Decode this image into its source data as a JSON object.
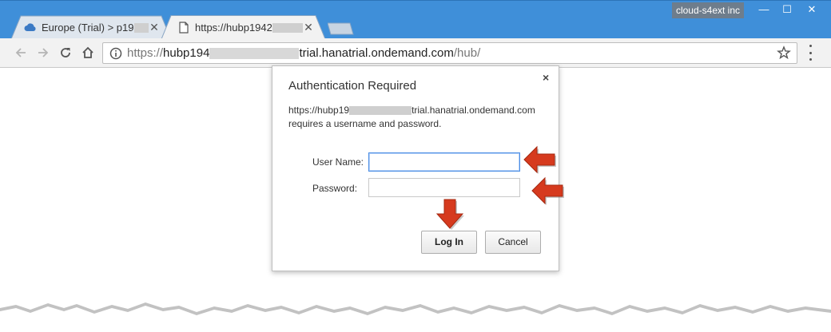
{
  "window": {
    "profile_name": "cloud-s4ext inc",
    "min_glyph": "—",
    "max_glyph": "☐",
    "close_glyph": "✕"
  },
  "tabs": [
    {
      "title_prefix": "Europe (Trial) > p19",
      "icon": "cloud-icon",
      "active": false,
      "close_glyph": "✕"
    },
    {
      "title_prefix": "https://hubp1942",
      "icon": "page-icon",
      "active": true,
      "close_glyph": "✕"
    }
  ],
  "address_bar": {
    "scheme": "https://",
    "host_prefix": "hubp194",
    "host_suffix": "trial.hanatrial.ondemand.com",
    "path": "/hub/"
  },
  "dialog": {
    "title": "Authentication Required",
    "close_glyph": "×",
    "host_prefix": "https://hubp19",
    "host_suffix": "trial.hanatrial.ondemand.com",
    "message_line2": "requires a username and password.",
    "username_label": "User Name:",
    "username_value": "",
    "password_label": "Password:",
    "password_value": "",
    "login_label": "Log In",
    "cancel_label": "Cancel"
  },
  "colors": {
    "titlebar": "#3f8fd9",
    "arrow_red": "#d63a1e",
    "focus_blue": "#4c8ee4"
  }
}
